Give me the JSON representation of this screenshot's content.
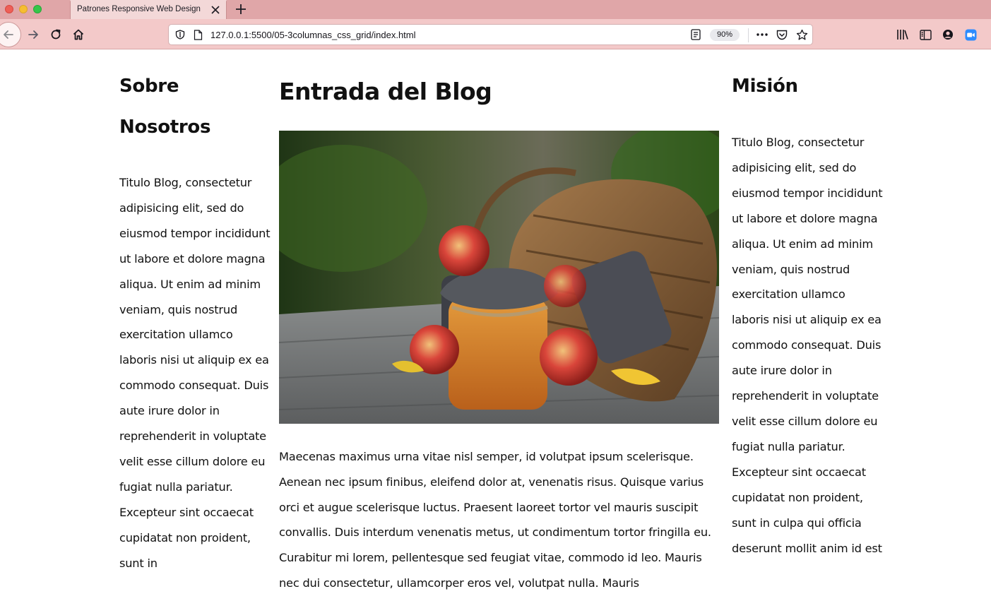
{
  "browser": {
    "tab_title": "Patrones Responsive Web Design",
    "url": "127.0.0.1:5500/05-3columnas_css_grid/index.html",
    "zoom": "90%",
    "colors": {
      "tabbar": "#e0a6a8",
      "toolbar": "#f3c9c9",
      "active_tab": "#f3d8d8"
    }
  },
  "page": {
    "left": {
      "heading": "Sobre Nosotros",
      "text": "Titulo Blog, consectetur adipisicing elit, sed do eiusmod tempor incididunt ut labore et dolore magna aliqua. Ut enim ad minim veniam, quis nostrud exercitation ullamco laboris nisi ut aliquip ex ea commodo consequat. Duis aute irure dolor in reprehenderit in voluptate velit esse cillum dolore eu fugiat nulla pariatur. Excepteur sint occaecat cupidatat non proident, sunt in"
    },
    "main": {
      "heading": "Entrada del Blog",
      "image": "photo-of-apples-jam-jar-and-wicker-basket",
      "text": "Maecenas maximus urna vitae nisl semper, id volutpat ipsum scelerisque. Aenean nec ipsum finibus, eleifend dolor at, venenatis risus. Quisque varius orci et augue scelerisque luctus. Praesent laoreet tortor vel mauris suscipit convallis. Duis interdum venenatis metus, ut condimentum tortor fringilla eu. Curabitur mi lorem, pellentesque sed feugiat vitae, commodo id leo. Mauris nec dui consectetur, ullamcorper eros vel, volutpat nulla. Mauris"
    },
    "right": {
      "heading": "Misión",
      "text": "Titulo Blog, consectetur adipisicing elit, sed do eiusmod tempor incididunt ut labore et dolore magna aliqua. Ut enim ad minim veniam, quis nostrud exercitation ullamco laboris nisi ut aliquip ex ea commodo consequat. Duis aute irure dolor in reprehenderit in voluptate velit esse cillum dolore eu fugiat nulla pariatur. Excepteur sint occaecat cupidatat non proident, sunt in culpa qui officia deserunt mollit anim id est"
    }
  }
}
